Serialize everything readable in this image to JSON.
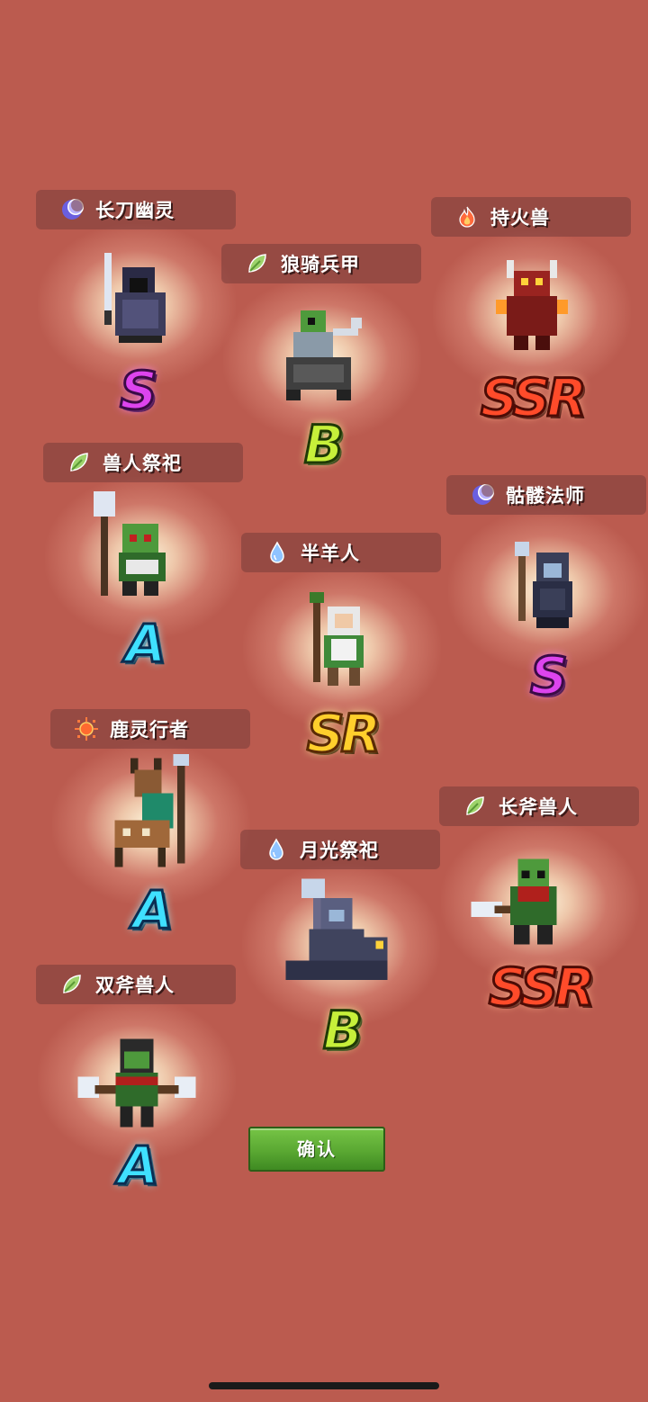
{
  "units": [
    {
      "name": "长刀幽灵",
      "element": "moon-icon",
      "rank": "S"
    },
    {
      "name": "狼骑兵甲",
      "element": "leaf-icon",
      "rank": "B"
    },
    {
      "name": "持火兽",
      "element": "fire-icon",
      "rank": "SSR"
    },
    {
      "name": "兽人祭祀",
      "element": "leaf-icon",
      "rank": "A"
    },
    {
      "name": "骷髅法师",
      "element": "moon-icon",
      "rank": "S"
    },
    {
      "name": "半羊人",
      "element": "water-drop-icon",
      "rank": "SR"
    },
    {
      "name": "鹿灵行者",
      "element": "sun-icon",
      "rank": "A"
    },
    {
      "name": "长斧兽人",
      "element": "leaf-icon",
      "rank": "SSR"
    },
    {
      "name": "月光祭祀",
      "element": "water-drop-icon",
      "rank": "B"
    },
    {
      "name": "双斧兽人",
      "element": "leaf-icon",
      "rank": "A"
    }
  ],
  "confirm_label": "确认",
  "colors": {
    "background": "#bb5b4f",
    "rank_S": "#dd44ee",
    "rank_A": "#3fe0ff",
    "rank_B": "#c6f03a",
    "rank_SR": "#ffcf2c",
    "rank_SSR": "#ff4b2a"
  }
}
